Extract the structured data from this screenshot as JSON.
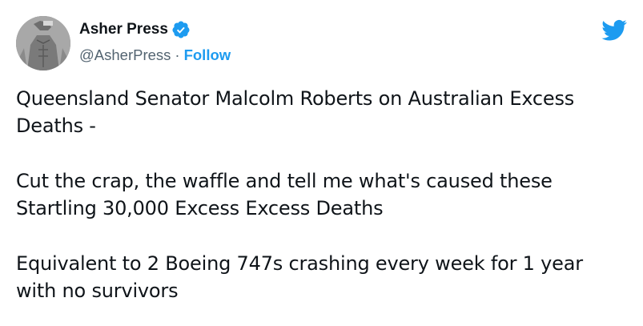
{
  "author": {
    "display_name": "Asher Press",
    "handle": "@AsherPress",
    "separator": "·",
    "follow_label": "Follow",
    "verified_icon": "verified-badge-icon",
    "avatar_icon": "avatar-portrait"
  },
  "brand": {
    "logo_icon": "twitter-bird-icon",
    "color": "#1d9bf0"
  },
  "tweet": {
    "paragraphs": [
      "Queensland Senator Malcolm Roberts on Australian Excess Deaths -",
      "Cut the crap, the waffle and tell me what's caused these Startling 30,000 Excess Excess Deaths",
      "Equivalent to 2 Boeing 747s crashing every week for 1 year with no survivors"
    ]
  }
}
